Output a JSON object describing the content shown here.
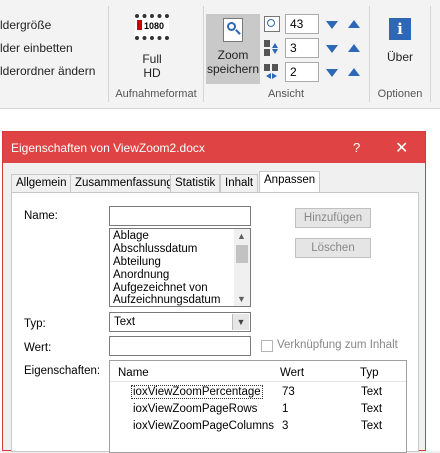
{
  "ribbon": {
    "commands": [
      "ldergröße",
      "lder einbetten",
      "lderordner ändern"
    ],
    "full_hd": {
      "badge": "1080",
      "line1": "Full",
      "line2": "HD"
    },
    "group_aufnahmeformat": "Aufnahmeformat",
    "zoom_button": {
      "line1": "Zoom",
      "line2": "speichern"
    },
    "spinners": {
      "zoom": "43",
      "rows": "3",
      "columns": "2"
    },
    "group_ansicht": "Ansicht",
    "info_button": "Über",
    "group_optionen": "Optionen"
  },
  "dialog": {
    "title": "Eigenschaften von ViewZoom2.docx",
    "help": "?",
    "close": "✕",
    "tabs": [
      "Allgemein",
      "Zusammenfassung",
      "Statistik",
      "Inhalt",
      "Anpassen"
    ],
    "active_tab": "Anpassen",
    "name_label": "Name:",
    "name_value": "",
    "add_button": "Hinzufügen",
    "delete_button": "Löschen",
    "name_options": [
      "Ablage",
      "Abschlussdatum",
      "Abteilung",
      "Anordnung",
      "Aufgezeichnet von",
      "Aufzeichnungsdatum"
    ],
    "type_label": "Typ:",
    "type_value": "Text",
    "value_label": "Wert:",
    "value_value": "",
    "link_label": "Verknüpfung zum Inhalt",
    "props_label": "Eigenschaften:",
    "table": {
      "headers": [
        "Name",
        "Wert",
        "Typ"
      ],
      "rows": [
        {
          "name": "ioxViewZoomPercentage",
          "value": "73",
          "type": "Text"
        },
        {
          "name": "ioxViewZoomPageRows",
          "value": "1",
          "type": "Text"
        },
        {
          "name": "ioxViewZoomPageColumns",
          "value": "3",
          "type": "Text"
        }
      ]
    }
  },
  "colors": {
    "title_bar": "#e04343",
    "accent_blue": "#2d67b5"
  }
}
